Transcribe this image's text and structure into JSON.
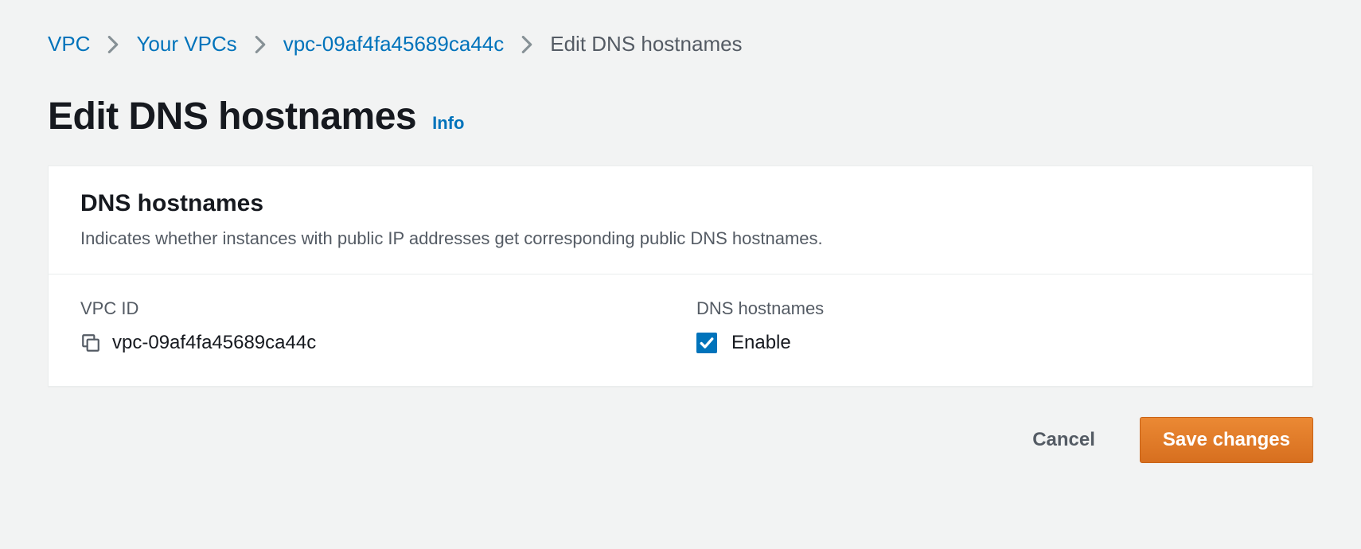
{
  "breadcrumb": {
    "items": [
      {
        "label": "VPC"
      },
      {
        "label": "Your VPCs"
      },
      {
        "label": "vpc-09af4fa45689ca44c"
      }
    ],
    "current": "Edit DNS hostnames"
  },
  "title": {
    "heading": "Edit DNS hostnames",
    "info": "Info"
  },
  "panel": {
    "heading": "DNS hostnames",
    "description": "Indicates whether instances with public IP addresses get corresponding public DNS hostnames.",
    "body": {
      "vpcid_label": "VPC ID",
      "vpcid_value": "vpc-09af4fa45689ca44c",
      "dns_label": "DNS hostnames",
      "enable_label": "Enable",
      "enable_checked": true
    }
  },
  "actions": {
    "cancel": "Cancel",
    "save": "Save changes"
  }
}
